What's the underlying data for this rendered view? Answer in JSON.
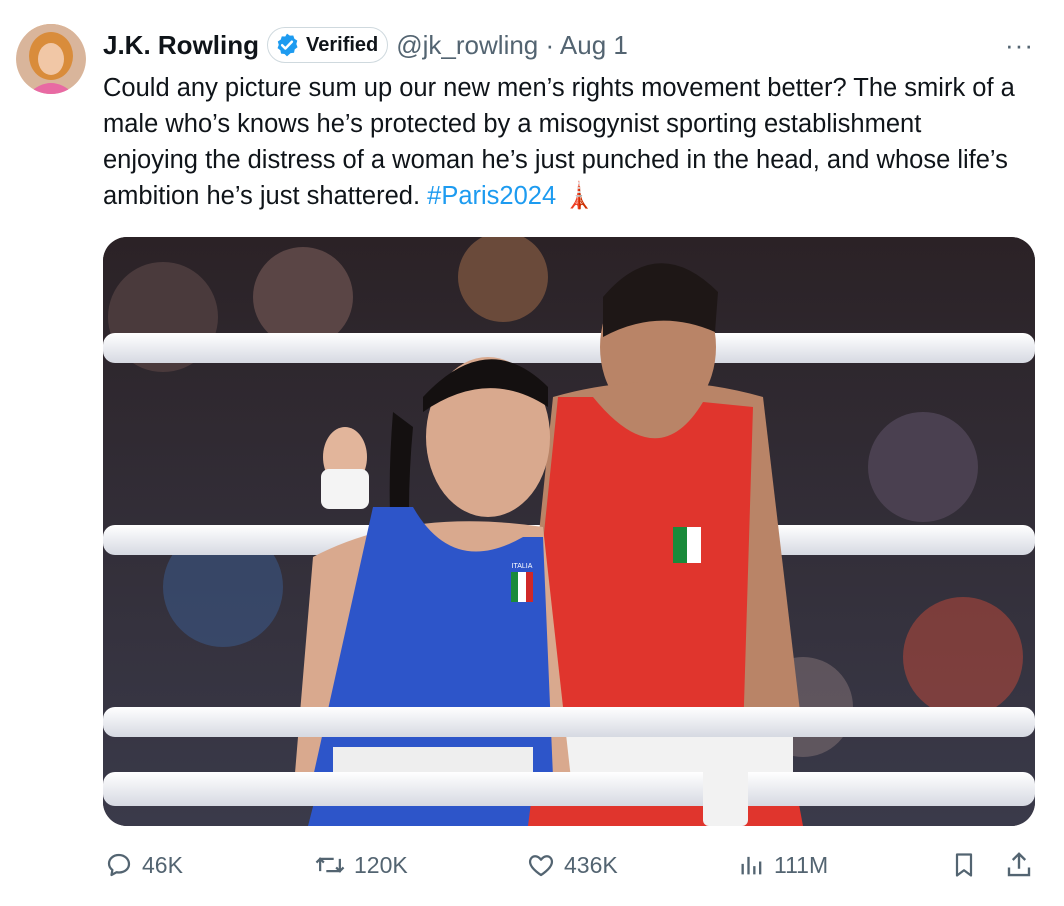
{
  "tweet": {
    "author_name": "J.K. Rowling",
    "verified_label": "Verified",
    "handle_meta": "@jk_rowling · Aug 1",
    "more_label": "···",
    "text_main": "Could any picture sum up our new men’s rights movement better? The smirk of a male who’s knows he’s protected by a misogynist sporting establishment enjoying the distress of a woman he’s just punched in the head, and whose life’s ambition he’s just shattered. ",
    "hashtag": "#Paris2024",
    "emoji": "🗼"
  },
  "media": {
    "image_icon": "boxing-ring-photo",
    "top_text": "ITALIA"
  },
  "actions": {
    "replies": "46K",
    "reposts": "120K",
    "likes": "436K",
    "views": "111M"
  },
  "colors": {
    "accent": "#1d9bf0",
    "muted": "#536471",
    "text": "#0f1419"
  }
}
